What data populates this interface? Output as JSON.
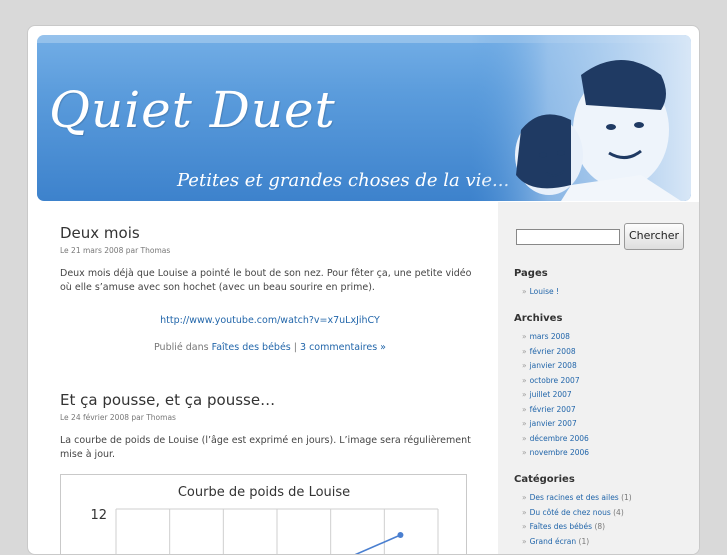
{
  "header": {
    "title": "Quiet Duet",
    "description": "Petites et grandes choses de la vie..."
  },
  "posts": [
    {
      "title": "Deux mois",
      "meta": "Le 21 mars 2008 par Thomas",
      "body": "Deux mois déjà que Louise a pointé le bout de son nez. Pour fêter ça, une petite vidéo où elle s’amuse avec son hochet (avec un beau sourire en prime).",
      "link": "http://www.youtube.com/watch?v=x7uLxJihCY",
      "foot_prefix": "Publié dans",
      "category": "Faîtes des bébés",
      "separator": "|",
      "comments": "3 commentaires »"
    },
    {
      "title": "Et ça pousse, et ça pousse…",
      "meta": "Le 24 février 2008 par Thomas",
      "body": "La courbe de poids de Louise (l’âge est exprimé en jours). L’image sera régulièrement mise à jour."
    }
  ],
  "chart_data": {
    "type": "line",
    "title": "Courbe de poids de Louise",
    "yticks": [
      12
    ],
    "series": [
      {
        "values": []
      }
    ],
    "color": "#4a7fd0"
  },
  "sidebar": {
    "search_button": "Chercher",
    "search_value": "",
    "pages_heading": "Pages",
    "pages": [
      "Louise !"
    ],
    "archives_heading": "Archives",
    "archives": [
      "mars 2008",
      "février 2008",
      "janvier 2008",
      "octobre 2007",
      "juillet 2007",
      "février 2007",
      "janvier 2007",
      "décembre 2006",
      "novembre 2006"
    ],
    "categories_heading": "Catégories",
    "categories": [
      {
        "name": "Des racines et des ailes",
        "count": "(1)"
      },
      {
        "name": "Du côté de chez nous",
        "count": "(4)"
      },
      {
        "name": "Faîtes des bébés",
        "count": "(8)"
      },
      {
        "name": "Grand écran",
        "count": "(1)"
      }
    ],
    "bullet": "»"
  },
  "colors": {
    "header": "#5b9cdc",
    "link": "#2266aa",
    "sidebar_bg": "#f1f1f1"
  }
}
